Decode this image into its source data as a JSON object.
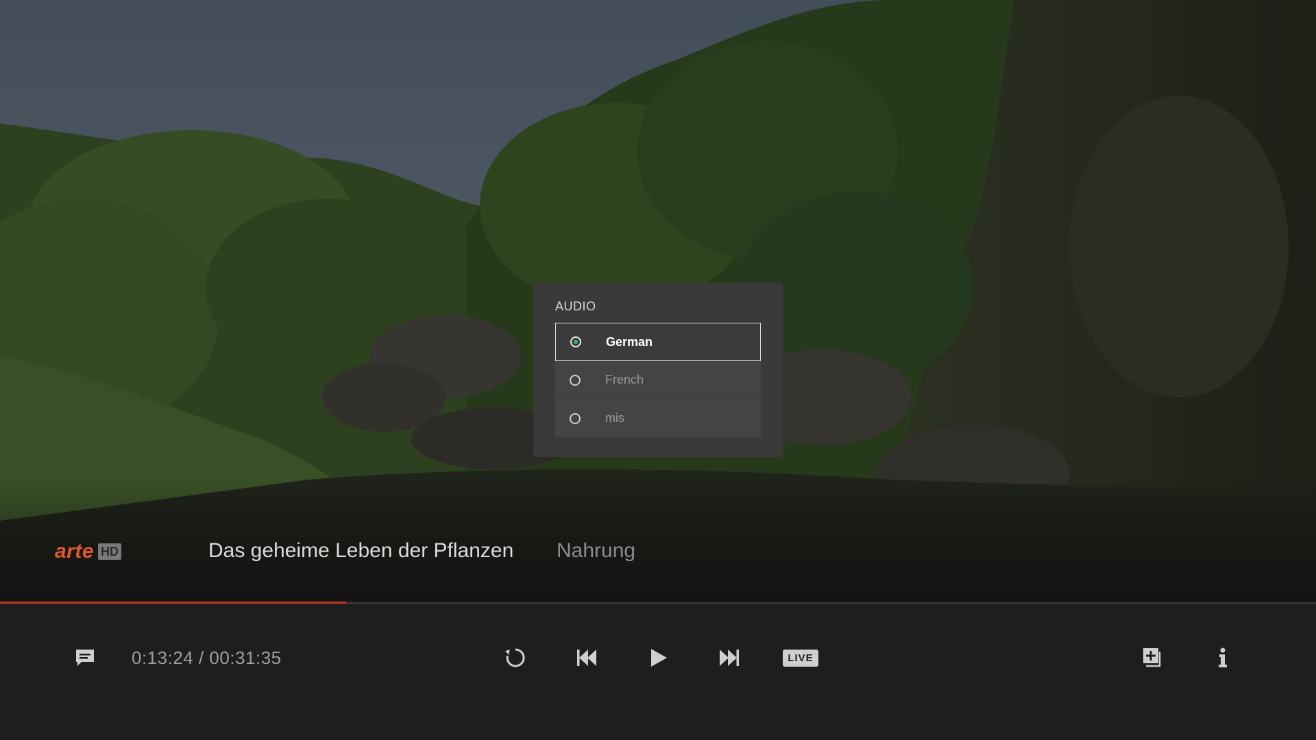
{
  "audio_menu": {
    "title": "AUDIO",
    "options": [
      {
        "label": "German",
        "selected": true
      },
      {
        "label": "French",
        "selected": false
      },
      {
        "label": "mis",
        "selected": false
      }
    ]
  },
  "channel": {
    "logo_text": "arte",
    "logo_badge": "HD"
  },
  "program": {
    "title": "Das geheime Leben der Pflanzen",
    "episode": "Nahrung"
  },
  "playback": {
    "time_readout": "0:13:24 / 00:31:35",
    "progress_fraction": 0.263,
    "live_label": "LIVE"
  },
  "colors": {
    "accent_progress": "#c0391f",
    "selected_radio": "#2fbf4a",
    "logo": "#e4572e"
  },
  "icons": {
    "subtitles": "subtitles-icon",
    "restart": "restart-icon",
    "rewind": "rewind-icon",
    "play": "play-icon",
    "fast_forward": "fast-forward-icon",
    "add": "add-to-list-icon",
    "info": "info-icon"
  }
}
